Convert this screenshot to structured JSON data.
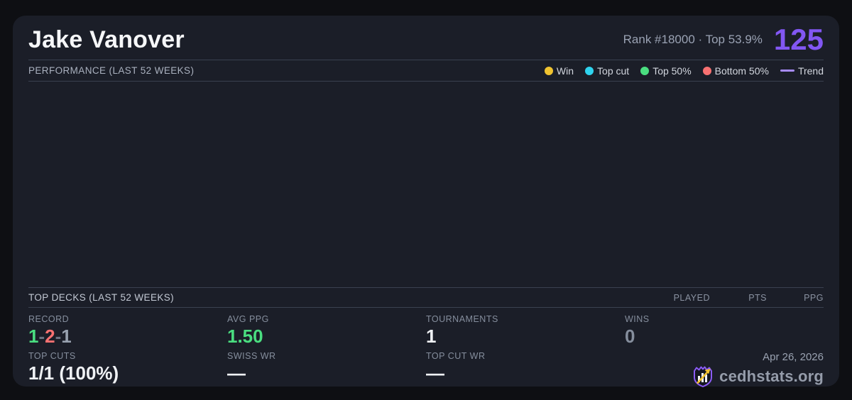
{
  "player": {
    "name": "Jake Vanover",
    "rank_text": "Rank #18000 · Top 53.9%",
    "score": "125"
  },
  "performance": {
    "title": "PERFORMANCE (LAST 52 WEEKS)",
    "legend": [
      {
        "label": "Win",
        "color": "#f0c330",
        "swatch": "dot"
      },
      {
        "label": "Top cut",
        "color": "#2fd3ee",
        "swatch": "dot"
      },
      {
        "label": "Top 50%",
        "color": "#4ade80",
        "swatch": "dot"
      },
      {
        "label": "Bottom 50%",
        "color": "#f87171",
        "swatch": "dot"
      },
      {
        "label": "Trend",
        "color": "#a78bfa",
        "swatch": "line"
      }
    ],
    "chart": {
      "series": [],
      "note_visible_points": "none"
    }
  },
  "top_decks": {
    "title": "TOP DECKS (LAST 52 WEEKS)",
    "columns": [
      "PLAYED",
      "PTS",
      "PPG"
    ],
    "rows": []
  },
  "stats": {
    "record": {
      "label": "RECORD",
      "parts": [
        {
          "text": "1",
          "color": "#4ade80"
        },
        {
          "text": "-",
          "color": "#6b7280"
        },
        {
          "text": "2",
          "color": "#f87171"
        },
        {
          "text": "-",
          "color": "#6b7280"
        },
        {
          "text": "1",
          "color": "#98a1af"
        }
      ]
    },
    "avg_ppg": {
      "label": "AVG PPG",
      "value": "1.50",
      "color": "#4ade80"
    },
    "tournaments": {
      "label": "TOURNAMENTS",
      "value": "1",
      "color": "#eff1f4"
    },
    "wins": {
      "label": "WINS",
      "value": "0",
      "color": "#858e9d"
    },
    "top_cuts": {
      "label": "TOP CUTS",
      "value": "1/1 (100%)",
      "color": "#eff1f4"
    },
    "swiss_wr": {
      "label": "SWISS WR",
      "value": "—",
      "color": "#eff1f4"
    },
    "top_cut_wr": {
      "label": "TOP CUT WR",
      "value": "—",
      "color": "#eff1f4"
    }
  },
  "footer": {
    "date": "Apr 26, 2026",
    "brand": "cedhstats.org"
  },
  "colors": {
    "page_bg": "#0e0f13",
    "card_bg": "#1b1e28",
    "divider": "#3a4150",
    "accent_purple": "#8257f3"
  }
}
